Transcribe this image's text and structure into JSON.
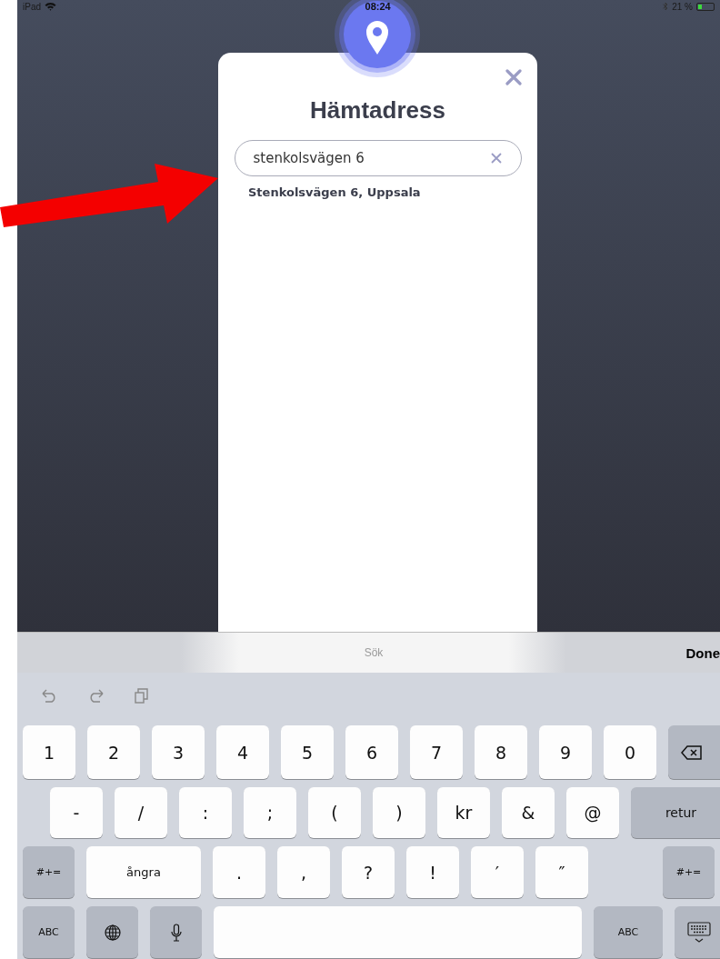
{
  "status_bar": {
    "device": "iPad",
    "time": "08:24",
    "battery": "21 %"
  },
  "dialog": {
    "title": "Hämtadress",
    "search": {
      "value": "stenkolsvägen 6"
    },
    "results": [
      "Stenkolsvägen 6, Uppsala"
    ]
  },
  "keyboard": {
    "suggestion": "Sök",
    "done": "Done",
    "rows": [
      [
        {
          "label": "1",
          "kind": "char"
        },
        {
          "label": "2",
          "kind": "char"
        },
        {
          "label": "3",
          "kind": "char"
        },
        {
          "label": "4",
          "kind": "char"
        },
        {
          "label": "5",
          "kind": "char"
        },
        {
          "label": "6",
          "kind": "char"
        },
        {
          "label": "7",
          "kind": "char"
        },
        {
          "label": "8",
          "kind": "char"
        },
        {
          "label": "9",
          "kind": "char"
        },
        {
          "label": "0",
          "kind": "char"
        },
        {
          "kind": "backspace"
        }
      ],
      [
        {
          "label": "-",
          "kind": "char"
        },
        {
          "label": "/",
          "kind": "char"
        },
        {
          "label": ":",
          "kind": "char"
        },
        {
          "label": ";",
          "kind": "char"
        },
        {
          "label": "(",
          "kind": "char"
        },
        {
          "label": ")",
          "kind": "char"
        },
        {
          "label": "kr",
          "kind": "char"
        },
        {
          "label": "&",
          "kind": "char"
        },
        {
          "label": "@",
          "kind": "char"
        },
        {
          "label": "retur",
          "kind": "return"
        }
      ],
      [
        {
          "label": "#+=",
          "kind": "mod"
        },
        {
          "label": "ångra",
          "kind": "undo"
        },
        {
          "label": ".",
          "kind": "char"
        },
        {
          "label": ",",
          "kind": "char"
        },
        {
          "label": "?",
          "kind": "char"
        },
        {
          "label": "!",
          "kind": "char"
        },
        {
          "label": "′",
          "kind": "char"
        },
        {
          "label": "″",
          "kind": "char"
        },
        {
          "label": "#+=",
          "kind": "mod"
        }
      ],
      [
        {
          "label": "ABC",
          "kind": "mod"
        },
        {
          "kind": "globe"
        },
        {
          "kind": "mic"
        },
        {
          "kind": "space"
        },
        {
          "label": "ABC",
          "kind": "mod"
        },
        {
          "kind": "hide"
        }
      ]
    ]
  }
}
